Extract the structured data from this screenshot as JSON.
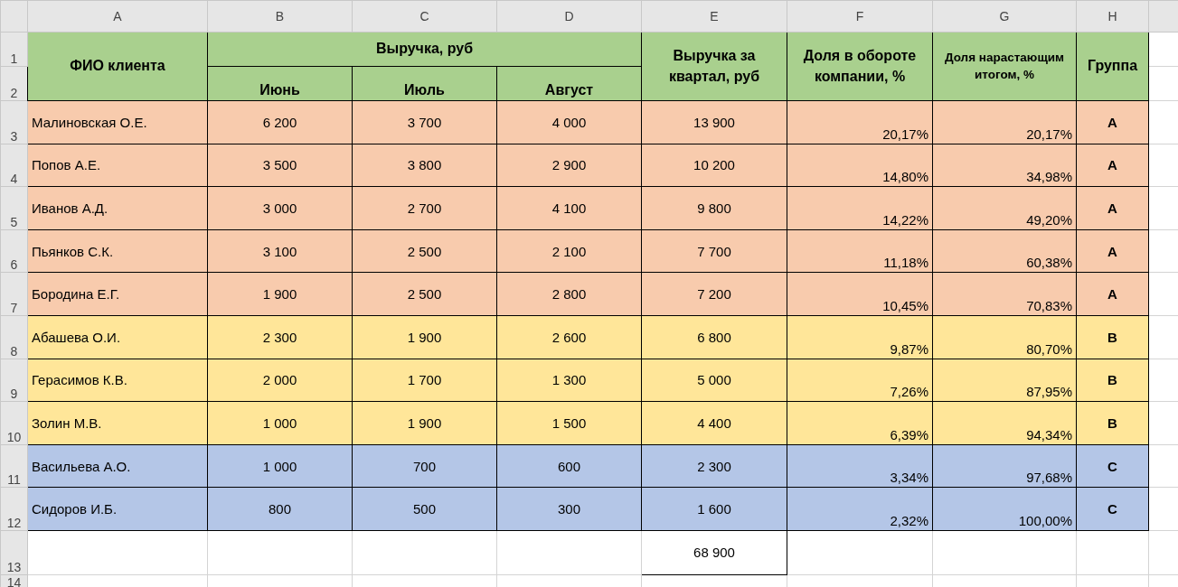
{
  "column_headers": [
    "A",
    "B",
    "C",
    "D",
    "E",
    "F",
    "G",
    "H"
  ],
  "row_numbers": [
    "1",
    "2",
    "3",
    "4",
    "5",
    "6",
    "7",
    "8",
    "9",
    "10",
    "11",
    "12",
    "13",
    "14"
  ],
  "table": {
    "header": {
      "name": "ФИО клиента",
      "revenue": "Выручка, руб",
      "months": [
        "Июнь",
        "Июль",
        "Август"
      ],
      "quarter": "Выручка за квартал, руб",
      "share": "Доля в обороте компании, %",
      "cumulative": "Доля нарастающим итогом, %",
      "group": "Группа"
    },
    "rows": [
      {
        "name": "Малиновская О.Е.",
        "months": [
          "6 200",
          "3 700",
          "4 000"
        ],
        "quarter": "13 900",
        "share": "20,17%",
        "cumulative": "20,17%",
        "group": "A",
        "color": "#f8cbad"
      },
      {
        "name": "Попов А.Е.",
        "months": [
          "3 500",
          "3 800",
          "2 900"
        ],
        "quarter": "10 200",
        "share": "14,80%",
        "cumulative": "34,98%",
        "group": "A",
        "color": "#f8cbad"
      },
      {
        "name": "Иванов А.Д.",
        "months": [
          "3 000",
          "2 700",
          "4 100"
        ],
        "quarter": "9 800",
        "share": "14,22%",
        "cumulative": "49,20%",
        "group": "A",
        "color": "#f8cbad"
      },
      {
        "name": "Пьянков С.К.",
        "months": [
          "3 100",
          "2 500",
          "2 100"
        ],
        "quarter": "7 700",
        "share": "11,18%",
        "cumulative": "60,38%",
        "group": "A",
        "color": "#f8cbad"
      },
      {
        "name": "Бородина Е.Г.",
        "months": [
          "1 900",
          "2 500",
          "2 800"
        ],
        "quarter": "7 200",
        "share": "10,45%",
        "cumulative": "70,83%",
        "group": "A",
        "color": "#f8cbad"
      },
      {
        "name": "Абашева О.И.",
        "months": [
          "2 300",
          "1 900",
          "2 600"
        ],
        "quarter": "6 800",
        "share": "9,87%",
        "cumulative": "80,70%",
        "group": "B",
        "color": "#ffe699"
      },
      {
        "name": "Герасимов К.В.",
        "months": [
          "2 000",
          "1 700",
          "1 300"
        ],
        "quarter": "5 000",
        "share": "7,26%",
        "cumulative": "87,95%",
        "group": "B",
        "color": "#ffe699"
      },
      {
        "name": "Золин М.В.",
        "months": [
          "1 000",
          "1 900",
          "1 500"
        ],
        "quarter": "4 400",
        "share": "6,39%",
        "cumulative": "94,34%",
        "group": "B",
        "color": "#ffe699"
      },
      {
        "name": "Васильева А.О.",
        "months": [
          "1 000",
          "700",
          "600"
        ],
        "quarter": "2 300",
        "share": "3,34%",
        "cumulative": "97,68%",
        "group": "C",
        "color": "#b4c6e7"
      },
      {
        "name": "Сидоров И.Б.",
        "months": [
          "800",
          "500",
          "300"
        ],
        "quarter": "1 600",
        "share": "2,32%",
        "cumulative": "100,00%",
        "group": "C",
        "color": "#b4c6e7"
      }
    ],
    "total": "68 900"
  }
}
